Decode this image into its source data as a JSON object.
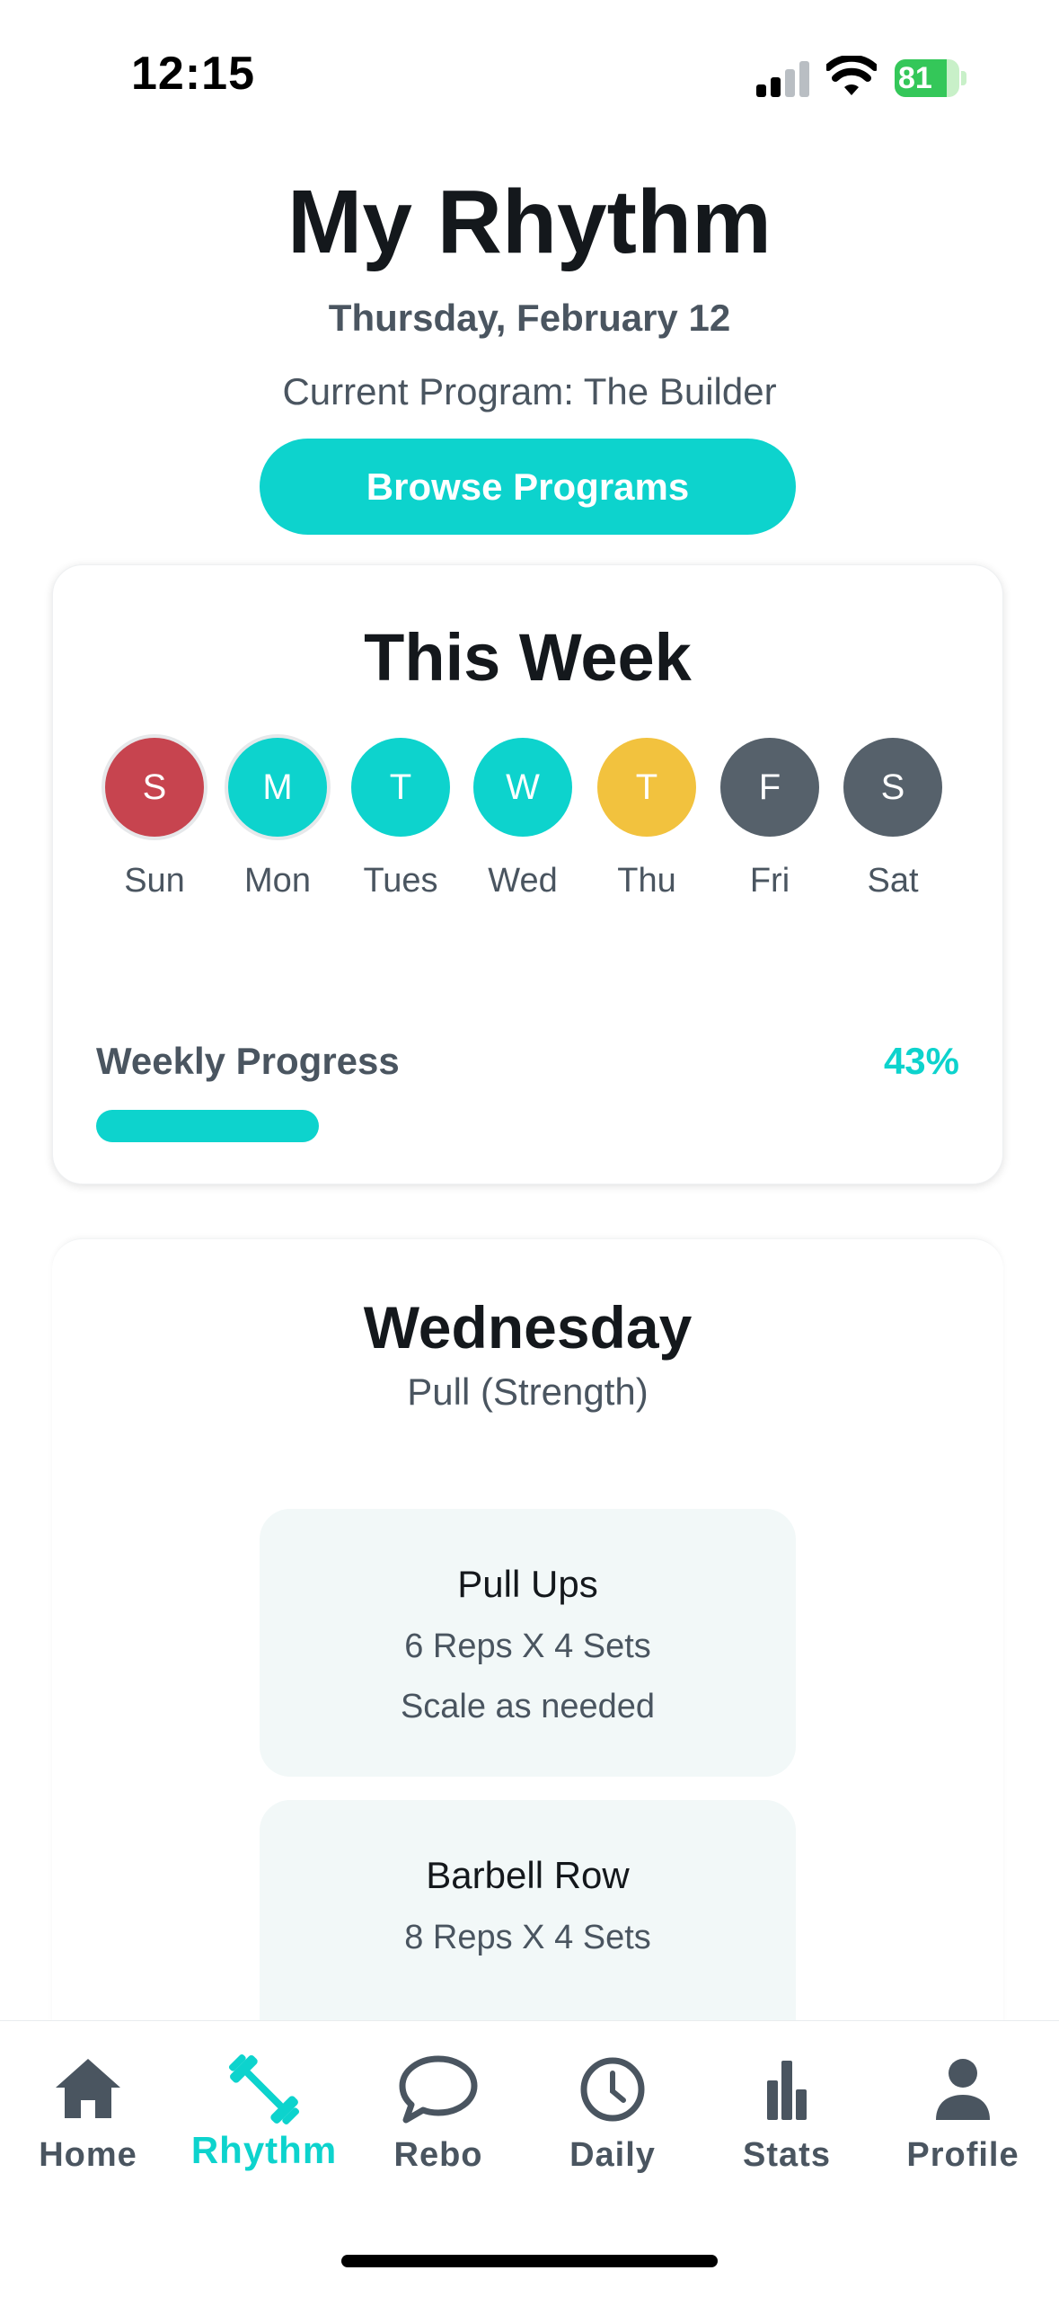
{
  "status_bar": {
    "time": "12:15",
    "battery": "81",
    "battery_level": 0.81
  },
  "header": {
    "title": "My Rhythm",
    "date": "Thursday, February 12",
    "program": "Current Program: The Builder",
    "browse_label": "Browse Programs"
  },
  "week": {
    "title": "This Week",
    "days": [
      {
        "letter": "S",
        "label": "Sun",
        "color": "#c7444f",
        "ring": true
      },
      {
        "letter": "M",
        "label": "Mon",
        "color": "#0dd3cd",
        "ring": true
      },
      {
        "letter": "T",
        "label": "Tues",
        "color": "#0dd3cd",
        "ring": false
      },
      {
        "letter": "W",
        "label": "Wed",
        "color": "#0dd3cd",
        "ring": false
      },
      {
        "letter": "T",
        "label": "Thu",
        "color": "#f2c23e",
        "ring": false
      },
      {
        "letter": "F",
        "label": "Fri",
        "color": "#56616b",
        "ring": false
      },
      {
        "letter": "S",
        "label": "Sat",
        "color": "#56616b",
        "ring": false
      }
    ],
    "progress_label": "Weekly Progress",
    "progress_text": "43%",
    "progress_value": 0.43
  },
  "workout": {
    "day": "Wednesday",
    "type": "Pull (Strength)",
    "exercises": [
      {
        "name": "Pull Ups",
        "lines": [
          "6 Reps X 4 Sets",
          "Scale as needed"
        ]
      },
      {
        "name": "Barbell Row",
        "lines": [
          "8 Reps X 4 Sets"
        ]
      }
    ]
  },
  "tabs": [
    {
      "label": "Home",
      "icon": "home-icon",
      "active": false
    },
    {
      "label": "Rhythm",
      "icon": "dumbbell-icon",
      "active": true
    },
    {
      "label": "Rebo",
      "icon": "chat-bubble-icon",
      "active": false
    },
    {
      "label": "Daily",
      "icon": "clock-icon",
      "active": false
    },
    {
      "label": "Stats",
      "icon": "bar-chart-icon",
      "active": false
    },
    {
      "label": "Profile",
      "icon": "person-icon",
      "active": false
    }
  ],
  "colors": {
    "accent": "#0dd3cd",
    "text_dark": "#14181c",
    "text_muted": "#4a5560",
    "inactive_tab": "#4a5560"
  }
}
